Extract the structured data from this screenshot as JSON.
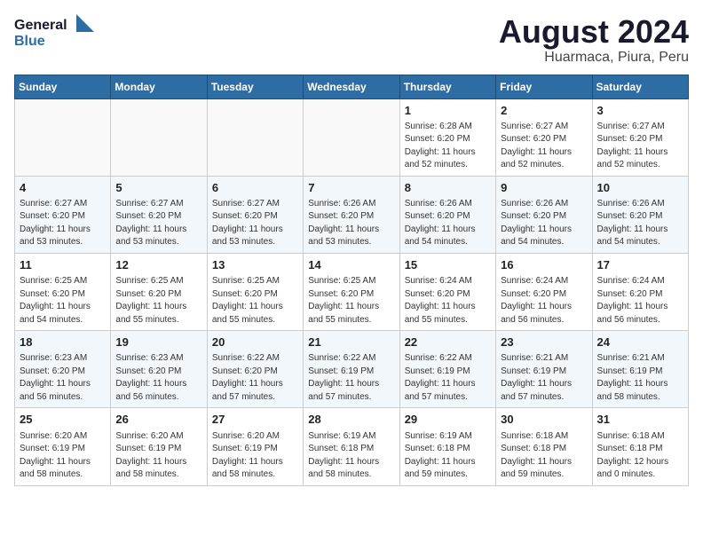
{
  "logo": {
    "line1": "General",
    "line2": "Blue"
  },
  "title": "August 2024",
  "location": "Huarmaca, Piura, Peru",
  "days_of_week": [
    "Sunday",
    "Monday",
    "Tuesday",
    "Wednesday",
    "Thursday",
    "Friday",
    "Saturday"
  ],
  "weeks": [
    [
      {
        "num": "",
        "info": ""
      },
      {
        "num": "",
        "info": ""
      },
      {
        "num": "",
        "info": ""
      },
      {
        "num": "",
        "info": ""
      },
      {
        "num": "1",
        "info": "Sunrise: 6:28 AM\nSunset: 6:20 PM\nDaylight: 11 hours\nand 52 minutes."
      },
      {
        "num": "2",
        "info": "Sunrise: 6:27 AM\nSunset: 6:20 PM\nDaylight: 11 hours\nand 52 minutes."
      },
      {
        "num": "3",
        "info": "Sunrise: 6:27 AM\nSunset: 6:20 PM\nDaylight: 11 hours\nand 52 minutes."
      }
    ],
    [
      {
        "num": "4",
        "info": "Sunrise: 6:27 AM\nSunset: 6:20 PM\nDaylight: 11 hours\nand 53 minutes."
      },
      {
        "num": "5",
        "info": "Sunrise: 6:27 AM\nSunset: 6:20 PM\nDaylight: 11 hours\nand 53 minutes."
      },
      {
        "num": "6",
        "info": "Sunrise: 6:27 AM\nSunset: 6:20 PM\nDaylight: 11 hours\nand 53 minutes."
      },
      {
        "num": "7",
        "info": "Sunrise: 6:26 AM\nSunset: 6:20 PM\nDaylight: 11 hours\nand 53 minutes."
      },
      {
        "num": "8",
        "info": "Sunrise: 6:26 AM\nSunset: 6:20 PM\nDaylight: 11 hours\nand 54 minutes."
      },
      {
        "num": "9",
        "info": "Sunrise: 6:26 AM\nSunset: 6:20 PM\nDaylight: 11 hours\nand 54 minutes."
      },
      {
        "num": "10",
        "info": "Sunrise: 6:26 AM\nSunset: 6:20 PM\nDaylight: 11 hours\nand 54 minutes."
      }
    ],
    [
      {
        "num": "11",
        "info": "Sunrise: 6:25 AM\nSunset: 6:20 PM\nDaylight: 11 hours\nand 54 minutes."
      },
      {
        "num": "12",
        "info": "Sunrise: 6:25 AM\nSunset: 6:20 PM\nDaylight: 11 hours\nand 55 minutes."
      },
      {
        "num": "13",
        "info": "Sunrise: 6:25 AM\nSunset: 6:20 PM\nDaylight: 11 hours\nand 55 minutes."
      },
      {
        "num": "14",
        "info": "Sunrise: 6:25 AM\nSunset: 6:20 PM\nDaylight: 11 hours\nand 55 minutes."
      },
      {
        "num": "15",
        "info": "Sunrise: 6:24 AM\nSunset: 6:20 PM\nDaylight: 11 hours\nand 55 minutes."
      },
      {
        "num": "16",
        "info": "Sunrise: 6:24 AM\nSunset: 6:20 PM\nDaylight: 11 hours\nand 56 minutes."
      },
      {
        "num": "17",
        "info": "Sunrise: 6:24 AM\nSunset: 6:20 PM\nDaylight: 11 hours\nand 56 minutes."
      }
    ],
    [
      {
        "num": "18",
        "info": "Sunrise: 6:23 AM\nSunset: 6:20 PM\nDaylight: 11 hours\nand 56 minutes."
      },
      {
        "num": "19",
        "info": "Sunrise: 6:23 AM\nSunset: 6:20 PM\nDaylight: 11 hours\nand 56 minutes."
      },
      {
        "num": "20",
        "info": "Sunrise: 6:22 AM\nSunset: 6:20 PM\nDaylight: 11 hours\nand 57 minutes."
      },
      {
        "num": "21",
        "info": "Sunrise: 6:22 AM\nSunset: 6:19 PM\nDaylight: 11 hours\nand 57 minutes."
      },
      {
        "num": "22",
        "info": "Sunrise: 6:22 AM\nSunset: 6:19 PM\nDaylight: 11 hours\nand 57 minutes."
      },
      {
        "num": "23",
        "info": "Sunrise: 6:21 AM\nSunset: 6:19 PM\nDaylight: 11 hours\nand 57 minutes."
      },
      {
        "num": "24",
        "info": "Sunrise: 6:21 AM\nSunset: 6:19 PM\nDaylight: 11 hours\nand 58 minutes."
      }
    ],
    [
      {
        "num": "25",
        "info": "Sunrise: 6:20 AM\nSunset: 6:19 PM\nDaylight: 11 hours\nand 58 minutes."
      },
      {
        "num": "26",
        "info": "Sunrise: 6:20 AM\nSunset: 6:19 PM\nDaylight: 11 hours\nand 58 minutes."
      },
      {
        "num": "27",
        "info": "Sunrise: 6:20 AM\nSunset: 6:19 PM\nDaylight: 11 hours\nand 58 minutes."
      },
      {
        "num": "28",
        "info": "Sunrise: 6:19 AM\nSunset: 6:18 PM\nDaylight: 11 hours\nand 58 minutes."
      },
      {
        "num": "29",
        "info": "Sunrise: 6:19 AM\nSunset: 6:18 PM\nDaylight: 11 hours\nand 59 minutes."
      },
      {
        "num": "30",
        "info": "Sunrise: 6:18 AM\nSunset: 6:18 PM\nDaylight: 11 hours\nand 59 minutes."
      },
      {
        "num": "31",
        "info": "Sunrise: 6:18 AM\nSunset: 6:18 PM\nDaylight: 12 hours\nand 0 minutes."
      }
    ]
  ]
}
